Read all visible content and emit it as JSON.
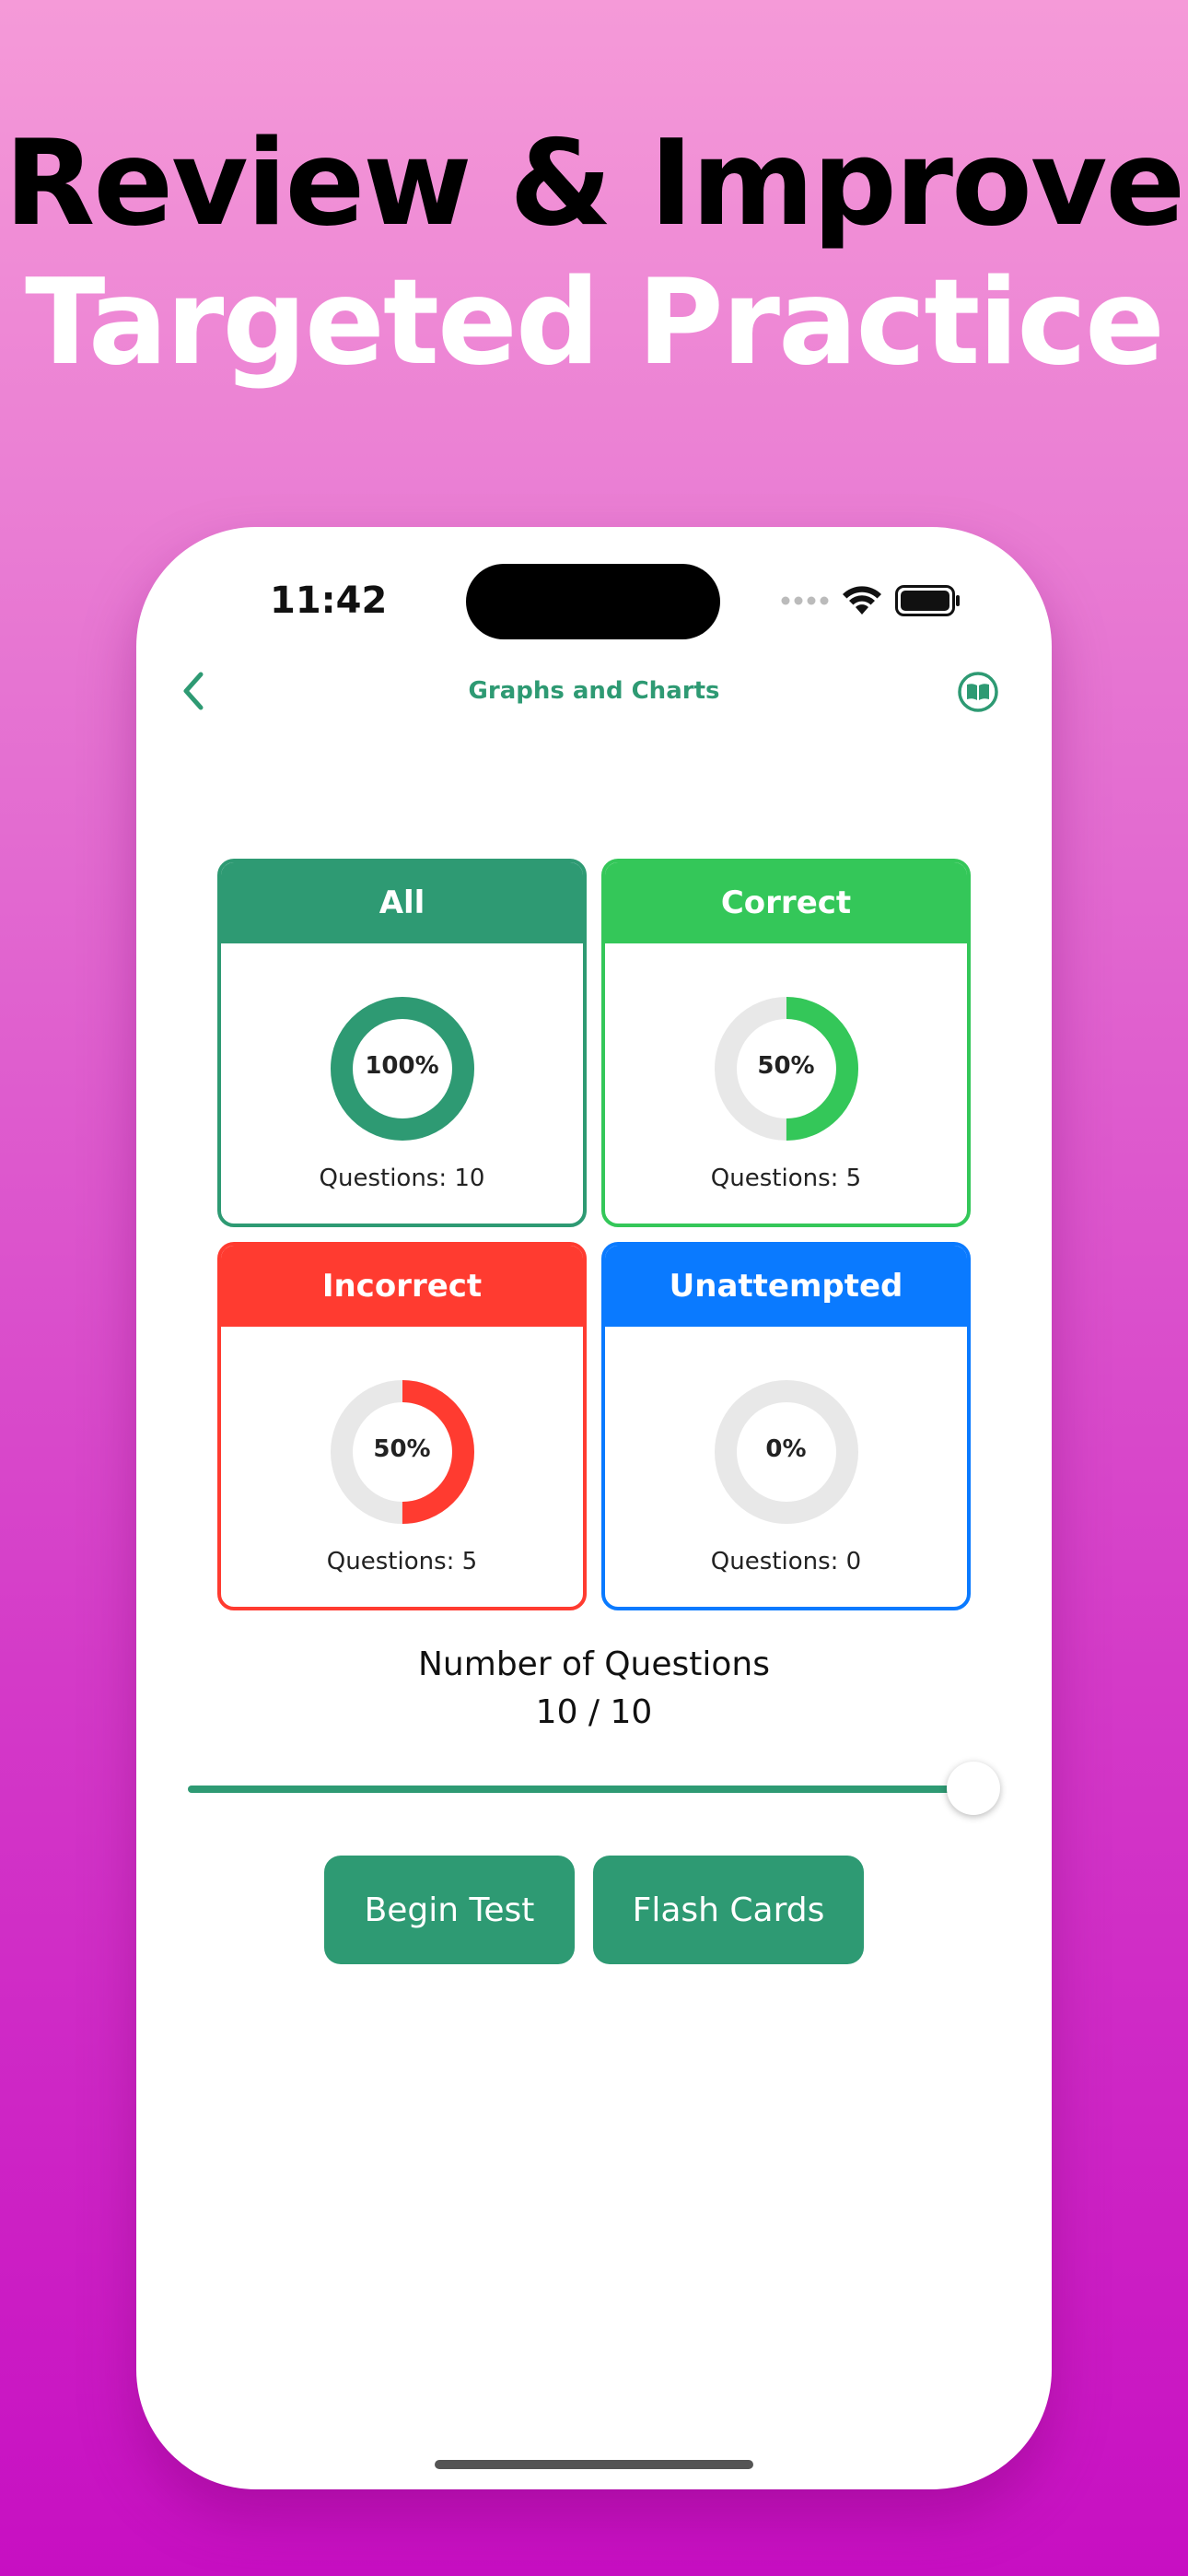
{
  "headline": {
    "line1": "Review & Improve",
    "line2": "Targeted Practice"
  },
  "status_bar": {
    "time": "11:42",
    "icons": [
      "signal-dots-icon",
      "wifi-icon",
      "battery-icon"
    ]
  },
  "nav": {
    "title": "Graphs and Charts",
    "back_icon": "chevron-left-icon",
    "right_icon": "book-icon"
  },
  "colors": {
    "accent": "#2e9a73",
    "correct": "#34c759",
    "incorrect": "#ff3b30",
    "unattempted": "#0a7aff",
    "donut_track": "#e8e8e8"
  },
  "cards": [
    {
      "title": "All",
      "percent_label": "100%",
      "percent": 100,
      "count_label": "Questions: 10",
      "color": "#2e9a73"
    },
    {
      "title": "Correct",
      "percent_label": "50%",
      "percent": 50,
      "count_label": "Questions: 5",
      "color": "#34c759"
    },
    {
      "title": "Incorrect",
      "percent_label": "50%",
      "percent": 50,
      "count_label": "Questions: 5",
      "color": "#ff3b30"
    },
    {
      "title": "Unattempted",
      "percent_label": "0%",
      "percent": 0,
      "count_label": "Questions: 0",
      "color": "#0a7aff"
    }
  ],
  "question_count": {
    "label": "Number of Questions",
    "value": "10 / 10",
    "current": 10,
    "max": 10
  },
  "buttons": {
    "begin_test": "Begin Test",
    "flash_cards": "Flash Cards"
  }
}
